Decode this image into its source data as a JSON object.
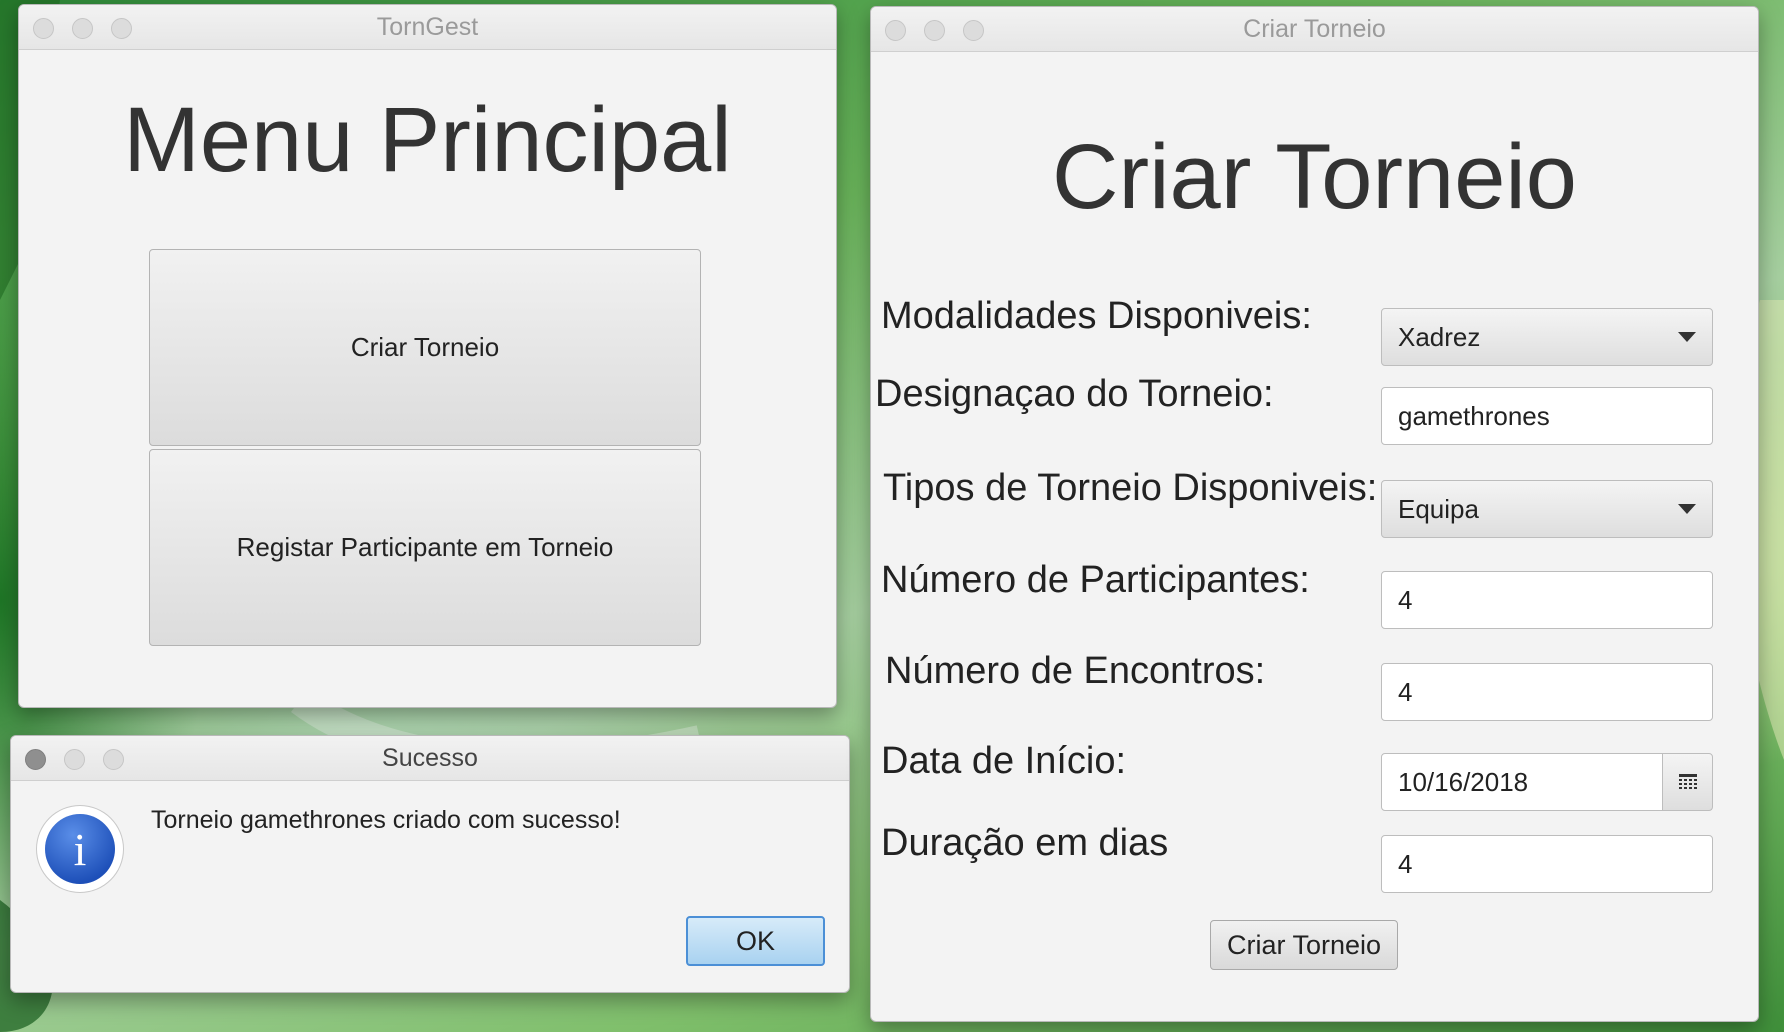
{
  "main_window": {
    "title": "TornGest",
    "heading": "Menu Principal",
    "buttons": {
      "criar": "Criar Torneio",
      "registar": "Registar Participante em Torneio"
    }
  },
  "success_dialog": {
    "title": "Sucesso",
    "icon": "info-icon",
    "icon_glyph": "i",
    "message": "Torneio gamethrones criado com sucesso!",
    "ok_label": "OK"
  },
  "criar_window": {
    "title": "Criar Torneio",
    "heading": "Criar Torneio",
    "fields": {
      "modalidades": {
        "label": "Modalidades Disponiveis:",
        "value": "Xadrez"
      },
      "designacao": {
        "label": "Designaçao do Torneio:",
        "value": "gamethrones"
      },
      "tipos": {
        "label": "Tipos de Torneio Disponiveis:",
        "value": "Equipa"
      },
      "participantes": {
        "label": "Número de Participantes:",
        "value": "4"
      },
      "encontros": {
        "label": "Número de Encontros:",
        "value": "4"
      },
      "data": {
        "label": "Data de Início:",
        "value": "10/16/2018"
      },
      "duracao": {
        "label": "Duração em dias",
        "value": "4"
      }
    },
    "submit_label": "Criar Torneio"
  },
  "colors": {
    "window_bg": "#f3f3f3",
    "accent_blue": "#4b8fd6",
    "desktop_green": "#3f8f3a"
  }
}
